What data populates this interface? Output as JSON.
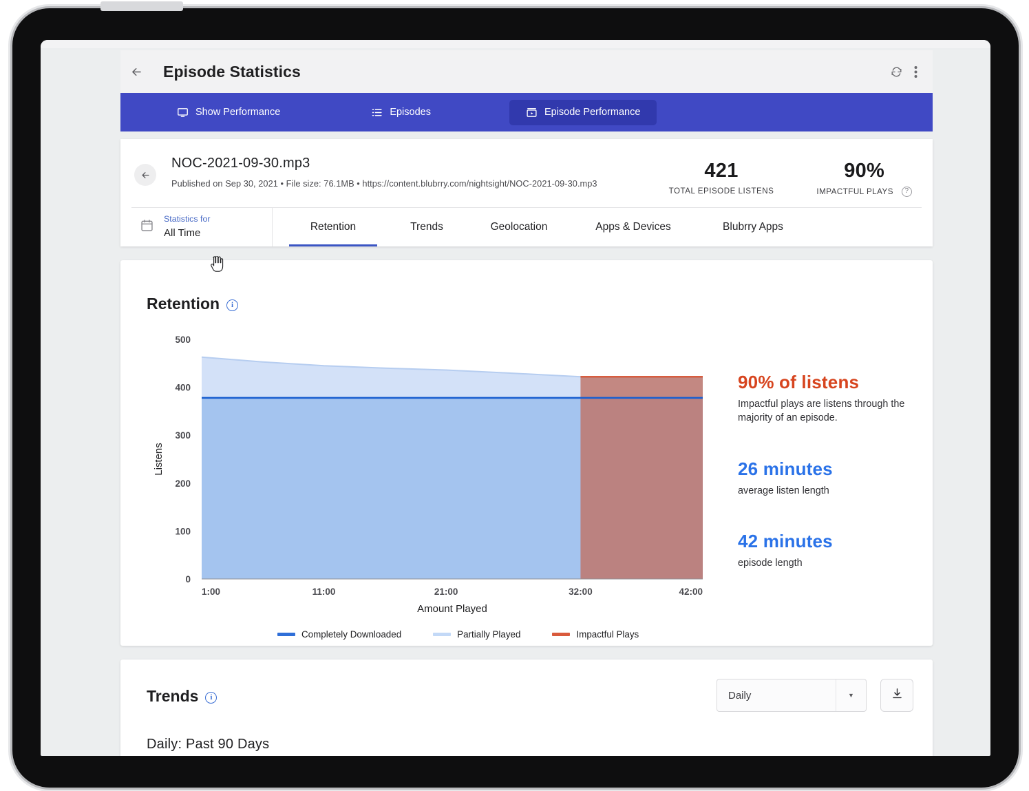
{
  "header": {
    "title": "Episode Statistics",
    "back_icon": "arrow-left-icon",
    "refresh_icon": "refresh-icon",
    "more_icon": "more-vertical-icon"
  },
  "primary_nav": {
    "items": [
      {
        "label": "Show Performance",
        "icon": "monitor-icon",
        "active": false
      },
      {
        "label": "Episodes",
        "icon": "list-icon",
        "active": false
      },
      {
        "label": "Episode Performance",
        "icon": "archive-play-icon",
        "active": true
      }
    ],
    "bar_color": "#4049c4",
    "active_color": "#3139ad"
  },
  "episode": {
    "filename": "NOC-2021-09-30.mp3",
    "subline": "Published on Sep 30, 2021 • File size: 76.1MB • https://content.blubrry.com/nightsight/NOC-2021-09-30.mp3",
    "back_icon": "arrow-left-icon",
    "stats": [
      {
        "value": "421",
        "label": "TOTAL EPISODE LISTENS",
        "help": false
      },
      {
        "value": "90%",
        "label": "IMPACTFUL PLAYS",
        "help": true
      }
    ]
  },
  "date_range": {
    "caption": "Statistics for",
    "value": "All Time",
    "icon": "calendar-icon"
  },
  "subtabs": [
    {
      "label": "Retention",
      "active": true
    },
    {
      "label": "Trends",
      "active": false
    },
    {
      "label": "Geolocation",
      "active": false
    },
    {
      "label": "Apps & Devices",
      "active": false
    },
    {
      "label": "Blubrry Apps",
      "active": false
    }
  ],
  "retention": {
    "heading": "Retention",
    "info_icon": "info-icon",
    "kpis": [
      {
        "value": "90% of listens",
        "desc": "Impactful plays are listens through the majority of an episode.",
        "color": "#d7451f"
      },
      {
        "value": "26 minutes",
        "desc": "average listen length",
        "color": "#2a72e8"
      },
      {
        "value": "42 minutes",
        "desc": "episode length",
        "color": "#2a72e8"
      }
    ]
  },
  "trends": {
    "heading": "Trends",
    "info_icon": "info-icon",
    "subheading": "Daily: Past 90 Days",
    "interval_value": "Daily",
    "interval_options": [
      "Daily"
    ],
    "download_icon": "download-icon",
    "caret_icon": "chevron-down-icon"
  },
  "chart_data": {
    "type": "area",
    "title": "Retention",
    "xlabel": "Amount Played",
    "ylabel": "Listens",
    "ylim": [
      0,
      500
    ],
    "yticks": [
      0,
      100,
      200,
      300,
      400,
      500
    ],
    "xtick_labels": [
      "1:00",
      "11:00",
      "21:00",
      "32:00",
      "42:00"
    ],
    "xtick_minutes": [
      1,
      11,
      21,
      32,
      42
    ],
    "xlim_minutes": [
      1,
      42
    ],
    "grid": false,
    "legend_position": "bottom",
    "series": [
      {
        "name": "Partially Played",
        "type": "area",
        "color": "#d3e1f8",
        "x": [
          1,
          6,
          11,
          16,
          21,
          26,
          32,
          42
        ],
        "values": [
          463,
          453,
          445,
          440,
          436,
          430,
          422,
          422
        ]
      },
      {
        "name": "Completely Downloaded",
        "type": "line-area",
        "color": "#a4c4ef",
        "line_color": "#1a5fd0",
        "x": [
          1,
          42
        ],
        "values": [
          378,
          378
        ]
      },
      {
        "name": "Impactful Plays",
        "type": "region",
        "color": "#c07468",
        "line_color": "#d7451f",
        "x_start": 32,
        "x_end": 42,
        "value": 422
      }
    ],
    "legend": [
      {
        "label": "Completely Downloaded",
        "color": "#2f6fd8"
      },
      {
        "label": "Partially Played",
        "color": "#c3d9f7"
      },
      {
        "label": "Impactful Plays",
        "color": "#d95a3c"
      }
    ]
  }
}
